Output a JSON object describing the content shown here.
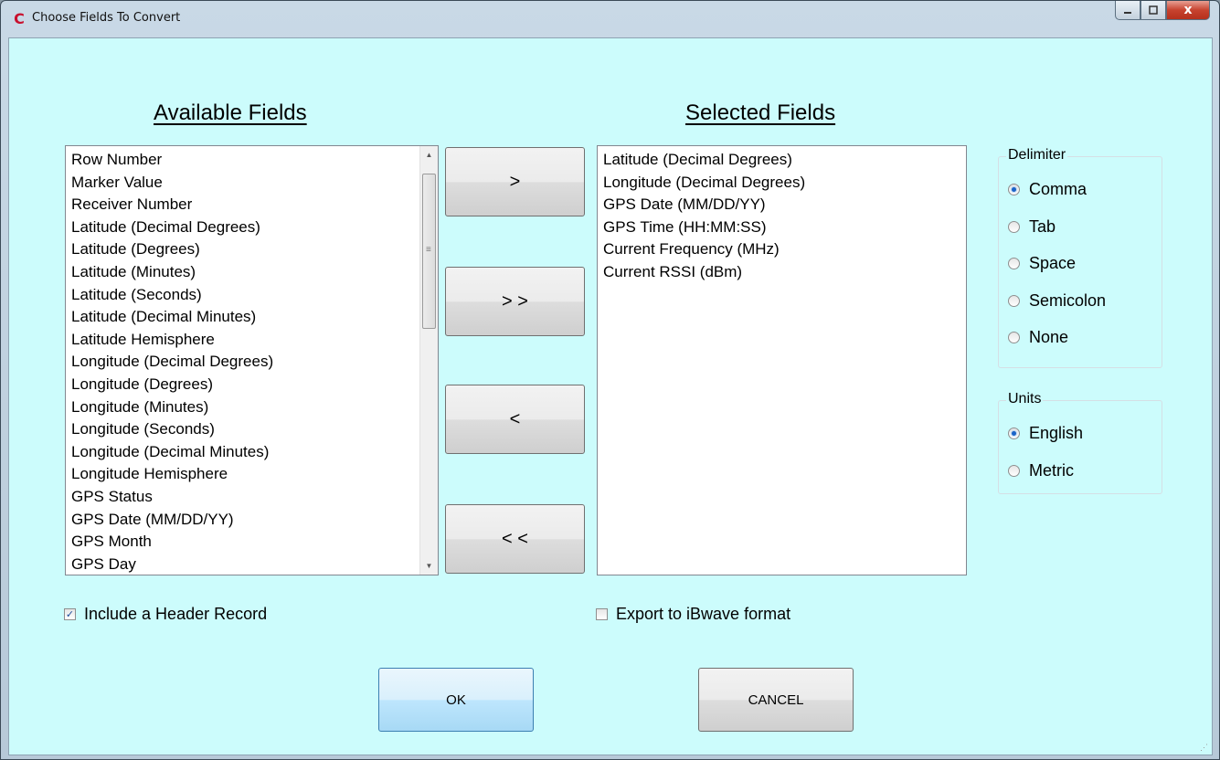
{
  "window": {
    "title": "Choose Fields To Convert",
    "icon": "C",
    "close_glyph": "x"
  },
  "available": {
    "heading": "Available Fields",
    "items": [
      "Row Number",
      "Marker Value",
      "Receiver Number",
      "Latitude (Decimal Degrees)",
      "Latitude (Degrees)",
      "Latitude (Minutes)",
      "Latitude (Seconds)",
      "Latitude (Decimal Minutes)",
      "Latitude Hemisphere",
      "Longitude (Decimal Degrees)",
      "Longitude (Degrees)",
      "Longitude (Minutes)",
      "Longitude (Seconds)",
      "Longitude (Decimal Minutes)",
      "Longitude Hemisphere",
      "GPS Status",
      "GPS Date (MM/DD/YY)",
      "GPS Month",
      "GPS Day"
    ]
  },
  "selected": {
    "heading": "Selected Fields",
    "items": [
      "Latitude (Decimal Degrees)",
      "Longitude (Decimal Degrees)",
      "GPS Date (MM/DD/YY)",
      "GPS Time (HH:MM:SS)",
      "Current Frequency (MHz)",
      "Current RSSI (dBm)"
    ]
  },
  "move_buttons": {
    "add": ">",
    "add_all": "> >",
    "remove": "<",
    "remove_all": "< <"
  },
  "delimiter": {
    "label": "Delimiter",
    "options": [
      "Comma",
      "Tab",
      "Space",
      "Semicolon",
      "None"
    ],
    "selected": "Comma"
  },
  "units": {
    "label": "Units",
    "options": [
      "English",
      "Metric"
    ],
    "selected": "English"
  },
  "include_header": {
    "label": "Include a Header Record",
    "checked": true,
    "mark": "✓"
  },
  "export_ibwave": {
    "label": "Export to iBwave format",
    "checked": false
  },
  "buttons": {
    "ok": "OK",
    "cancel": "CANCEL"
  },
  "colors": {
    "client_bg": "#ccfcfc",
    "radio_dot": "#1c64c8"
  }
}
